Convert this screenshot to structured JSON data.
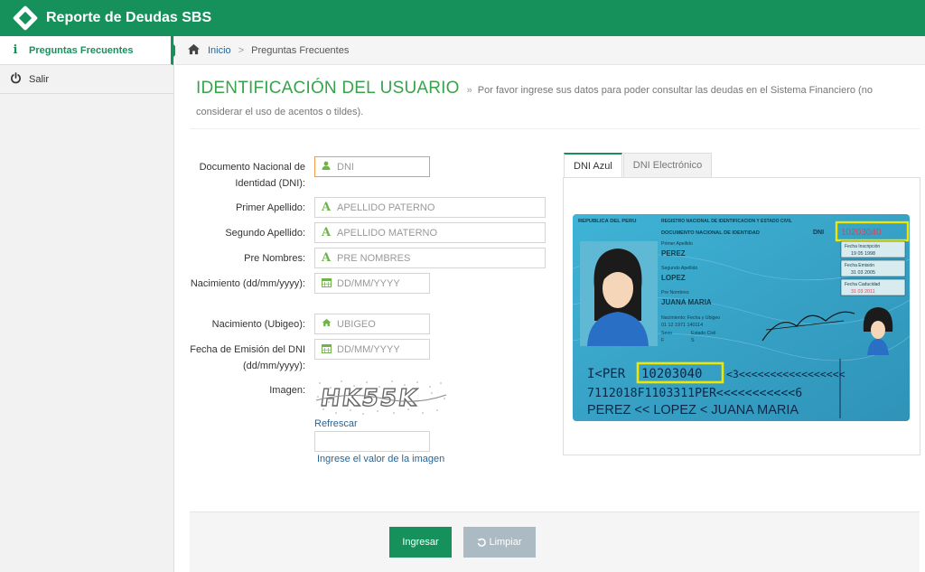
{
  "app": {
    "title": "Reporte de Deudas SBS"
  },
  "sidebar": {
    "items": [
      {
        "label": "Preguntas Frecuentes",
        "icon": "info-icon"
      },
      {
        "label": "Salir",
        "icon": "power-icon"
      }
    ]
  },
  "breadcrumb": {
    "home": "Inicio",
    "current": "Preguntas Frecuentes"
  },
  "heading": {
    "title": "IDENTIFICACIÓN DEL USUARIO",
    "arrow": "»",
    "description": "Por favor ingrese sus datos para poder consultar las deudas en el Sistema Financiero (no considerar el uso de acentos o tildes)."
  },
  "form": {
    "dni": {
      "label": "Documento Nacional de Identidad (DNI):",
      "placeholder": "DNI"
    },
    "apellido_paterno": {
      "label": "Primer Apellido:",
      "placeholder": "APELLIDO PATERNO"
    },
    "apellido_materno": {
      "label": "Segundo Apellido:",
      "placeholder": "APELLIDO MATERNO"
    },
    "nombres": {
      "label": "Pre Nombres:",
      "placeholder": "PRE NOMBRES"
    },
    "nacimiento": {
      "label": "Nacimiento (dd/mm/yyyy):",
      "placeholder": "DD/MM/YYYY"
    },
    "ubigeo": {
      "label": "Nacimiento (Ubigeo):",
      "placeholder": "UBIGEO"
    },
    "emision": {
      "label": "Fecha de Emisión del DNI (dd/mm/yyyy):",
      "placeholder": "DD/MM/YYYY"
    },
    "imagen": {
      "label": "Imagen:",
      "captcha_text": "HK55K",
      "refresh": "Refrescar",
      "hint": "Ingrese el valor de la imagen",
      "value": ""
    }
  },
  "tabs": [
    {
      "label": "DNI Azul",
      "active": true
    },
    {
      "label": "DNI Electrónico",
      "active": false
    }
  ],
  "dni_card": {
    "header_left": "REPUBLICA DEL PERU",
    "header_right": "REGISTRO NACIONAL DE IDENTIFICACION Y ESTADO CIVIL",
    "doc_title": "DOCUMENTO NACIONAL DE IDENTIDAD",
    "dni_label": "DNI",
    "dni_number": "10203040",
    "primer_apellido_label": "Primer Apellido",
    "primer_apellido": "PEREZ",
    "segundo_apellido_label": "Segundo Apellido",
    "segundo_apellido": "LOPEZ",
    "prenombres_label": "Pre Nombres",
    "prenombres": "JUANA MARIA",
    "nacimiento_label": "Nacimiento: Fecha y Ubigeo",
    "nacimiento_value": "01 12 1971    140114",
    "sexo_label": "Sexo",
    "sexo": "F",
    "estado_label": "Estado Civil",
    "estado": "S",
    "inscripcion_label": "Fecha Inscripción",
    "inscripcion": "19 05 1998",
    "emision_label": "Fecha Emisión",
    "emision": "31 03 2005",
    "caducidad_label": "Fecha Caducidad",
    "caducidad": "31 03 2011",
    "mrz1_prefix": "I<PER",
    "mrz1_number": "10203040",
    "mrz1_rest": "<3<<<<<<<<<<<<<<<<<",
    "mrz2": "7112018F1103311PER<<<<<<<<<<<6",
    "mrz3": "PEREZ << LOPEZ < JUANA MARIA",
    "colors": {
      "card": "#3aa9c9",
      "highlight": "#f2e600"
    }
  },
  "buttons": {
    "submit": "Ingresar",
    "clear": "Limpiar"
  },
  "colors": {
    "brand": "#17915c",
    "title": "#38a34b",
    "link": "#2a6496"
  }
}
